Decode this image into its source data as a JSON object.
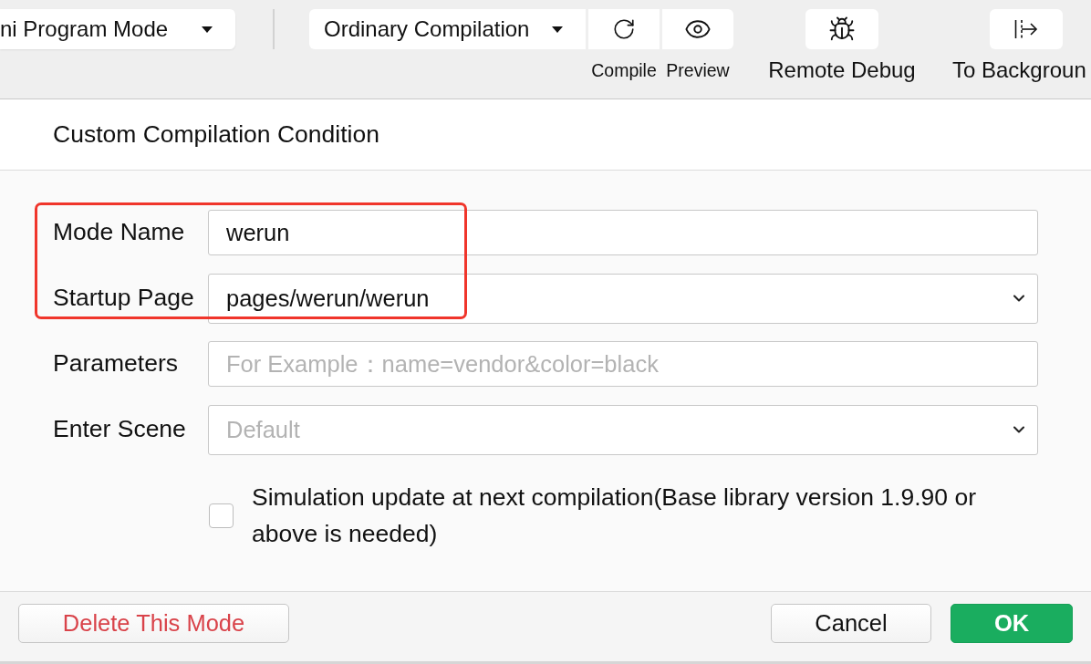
{
  "toolbar": {
    "mode_select": {
      "label": "ni Program Mode"
    },
    "compile_select": {
      "label": "Ordinary Compilation"
    },
    "actions": [
      {
        "kind": "compile",
        "label": "Compile"
      },
      {
        "kind": "preview",
        "label": "Preview"
      },
      {
        "kind": "remote_debug",
        "label": "Remote Debug"
      },
      {
        "kind": "to_background",
        "label": "To Backgroun"
      }
    ]
  },
  "dialog": {
    "title": "Custom Compilation Condition",
    "fields": [
      {
        "kind": "input",
        "label": "Mode Name",
        "value": "werun",
        "highlighted": true
      },
      {
        "kind": "select",
        "label": "Startup Page",
        "value": "pages/werun/werun",
        "highlighted": true
      },
      {
        "kind": "input",
        "label": "Parameters",
        "placeholder": "For Example：name=vendor&color=black",
        "highlighted": false
      },
      {
        "kind": "select",
        "label": "Enter Scene",
        "placeholder": "Default",
        "highlighted": false
      }
    ],
    "checkbox": {
      "label": "Simulation update at next compilation(Base library version 1.9.90 or above is needed)",
      "checked": false
    },
    "buttons": [
      {
        "kind": "danger",
        "label": "Delete This Mode"
      },
      {
        "kind": "default",
        "label": "Cancel"
      },
      {
        "kind": "primary",
        "label": "OK"
      }
    ]
  }
}
